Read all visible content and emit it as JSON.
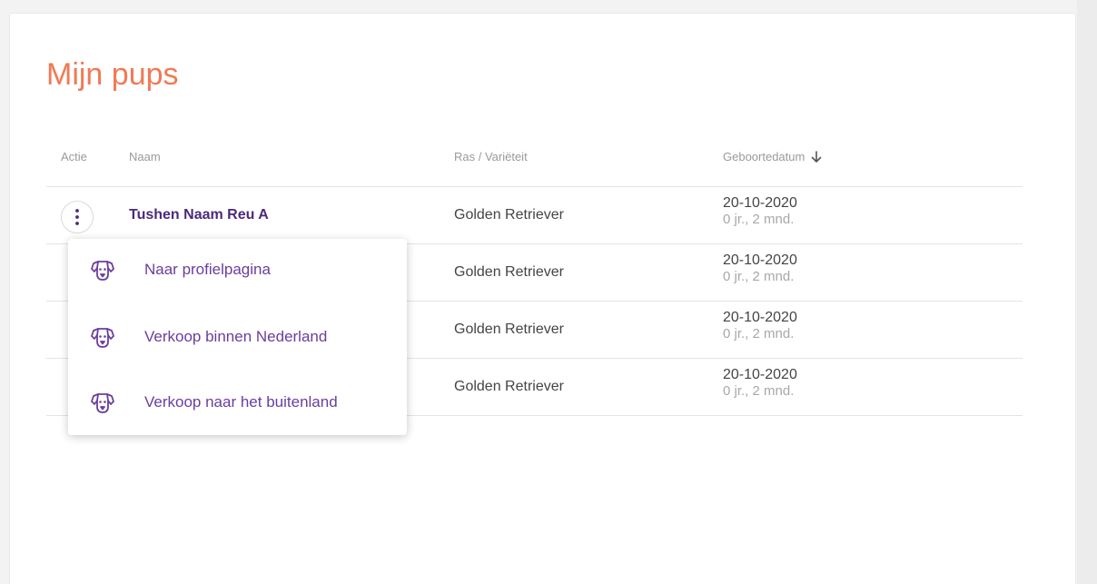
{
  "page": {
    "title": "Mijn pups"
  },
  "table": {
    "headers": {
      "actie": "Actie",
      "naam": "Naam",
      "ras": "Ras / Variëteit",
      "geboortedatum": "Geboortedatum"
    },
    "sort_icon": "arrow-down-icon",
    "rows": [
      {
        "naam": "Tushen Naam Reu A",
        "ras": "Golden Retriever",
        "datum": "20-10-2020",
        "leeftijd": "0 jr., 2 mnd."
      },
      {
        "naam": "",
        "ras": "Golden Retriever",
        "datum": "20-10-2020",
        "leeftijd": "0 jr., 2 mnd."
      },
      {
        "naam": "",
        "ras": "Golden Retriever",
        "datum": "20-10-2020",
        "leeftijd": "0 jr., 2 mnd."
      },
      {
        "naam": "",
        "ras": "Golden Retriever",
        "datum": "20-10-2020",
        "leeftijd": "0 jr., 2 mnd."
      }
    ]
  },
  "menu": {
    "icon": "dog-face-icon",
    "items": [
      {
        "label": "Naar profielpagina"
      },
      {
        "label": "Verkoop binnen Nederland"
      },
      {
        "label": "Verkoop naar het buitenland"
      }
    ]
  },
  "colors": {
    "title": "#f07a55",
    "accent_purple": "#6a3e9e",
    "name_purple": "#4b2a7a",
    "muted_text": "#9a9a9a"
  }
}
